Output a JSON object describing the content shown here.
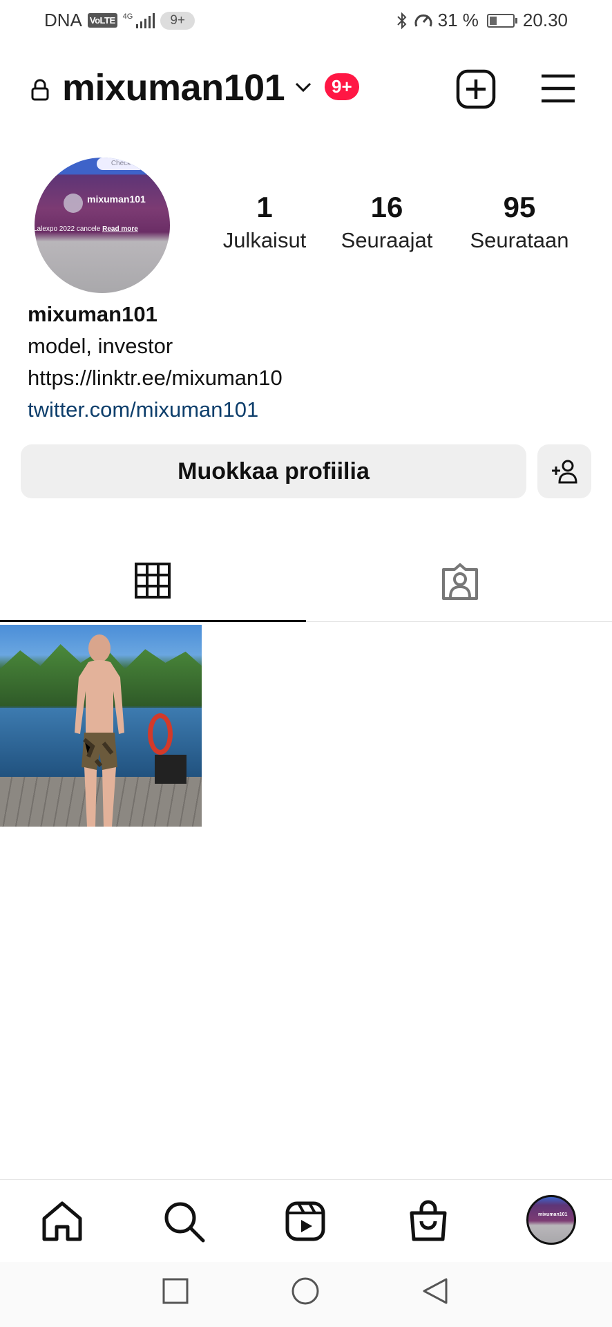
{
  "status_bar": {
    "carrier": "DNA",
    "volte": "VoLTE",
    "network": "4G",
    "notifications": "9+",
    "battery_percent": "31 %",
    "battery_level": 0.31,
    "time": "20.30"
  },
  "header": {
    "username": "mixuman101",
    "notification_badge": "9+"
  },
  "profile": {
    "avatar_text": "mixuman101",
    "avatar_caption": "Lalexpo 2022 cancele",
    "avatar_caption_link": "Read more",
    "avatar_pill": "Check",
    "stats": [
      {
        "value": "1",
        "label": "Julkaisut"
      },
      {
        "value": "16",
        "label": "Seuraajat"
      },
      {
        "value": "95",
        "label": "Seurataan"
      }
    ],
    "name": "mixuman101",
    "bio": "model, investor",
    "link1": "https://linktr.ee/mixuman10",
    "link2": "twitter.com/mixuman101",
    "edit_button": "Muokkaa profiilia"
  },
  "tabs": {
    "grid": "grid-icon",
    "tagged": "tagged-icon",
    "active": "grid"
  },
  "posts": [
    {
      "alt": "post-thumbnail"
    }
  ],
  "bottom_nav": {
    "items": [
      "home-icon",
      "search-icon",
      "reels-icon",
      "shop-icon",
      "profile-avatar"
    ],
    "avatar_text": "mixuman101"
  }
}
